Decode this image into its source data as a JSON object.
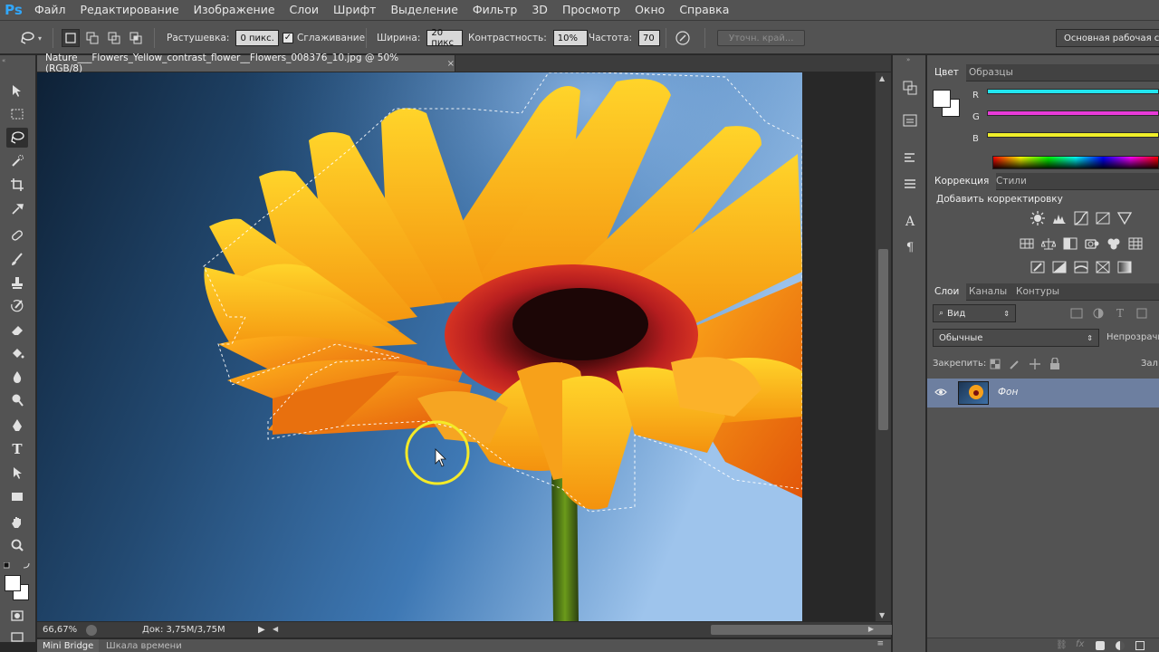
{
  "app": {
    "logo": "Ps"
  },
  "menu": [
    "Файл",
    "Редактирование",
    "Изображение",
    "Слои",
    "Шрифт",
    "Выделение",
    "Фильтр",
    "3D",
    "Просмотр",
    "Окно",
    "Справка"
  ],
  "options": {
    "feather_label": "Растушевка:",
    "feather_value": "0 пикс.",
    "antialias_label": "Сглаживание",
    "antialias_checked": true,
    "width_label": "Ширина:",
    "width_value": "20 пикс",
    "contrast_label": "Контрастность:",
    "contrast_value": "10%",
    "frequency_label": "Частота:",
    "frequency_value": "70",
    "refine_edge": "Уточн. край...",
    "workspace": "Основная рабочая среда"
  },
  "document": {
    "tab_title": "Nature___Flowers_Yellow_contrast_flower__Flowers_008376_10.jpg @ 50% (RGB/8)",
    "close": "×"
  },
  "status": {
    "zoom": "66,67%",
    "doc_info": "Док: 3,75M/3,75M"
  },
  "bottom_tabs": [
    "Mini Bridge",
    "Шкала времени"
  ],
  "color_panel": {
    "tabs": [
      "Цвет",
      "Образцы"
    ],
    "channels": [
      {
        "label": "R",
        "color": "#22e6f0"
      },
      {
        "label": "G",
        "color": "#e83ad8"
      },
      {
        "label": "B",
        "color": "#f0ee2a"
      }
    ]
  },
  "adjustments_panel": {
    "tabs": [
      "Коррекция",
      "Стили"
    ],
    "title": "Добавить корректировку"
  },
  "layers_panel": {
    "tabs": [
      "Слои",
      "Каналы",
      "Контуры"
    ],
    "kind_filter": "Вид",
    "blend_mode": "Обычные",
    "opacity_label": "Непрозрачн",
    "lock_label": "Закрепить:",
    "fill_label": "Зал",
    "layers": [
      {
        "name": "Фон",
        "visible": true
      }
    ]
  },
  "colors": {
    "accent_logo": "#31a8ff",
    "selection_circle": "#f4ea28",
    "panel_bg": "#535353"
  }
}
